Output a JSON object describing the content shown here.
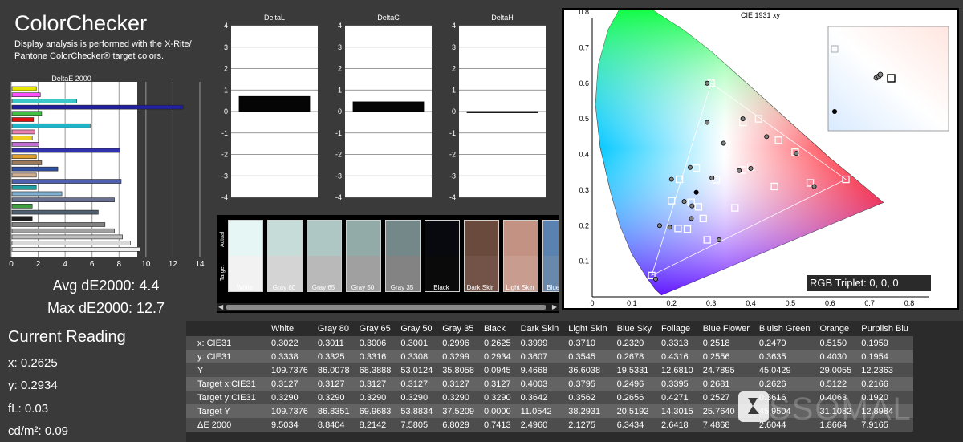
{
  "header": {
    "title": "ColorChecker",
    "subtitle": "Display analysis is performed with the X-Rite/ Pantone ColorChecker® target colors."
  },
  "deltaE_chart": {
    "title": "DeltaE 2000",
    "x_ticks": [
      "0",
      "2",
      "4",
      "6",
      "8",
      "10",
      "12",
      "14"
    ]
  },
  "summary": {
    "avg": "Avg dE2000: 4.4",
    "max": "Max dE2000: 12.7"
  },
  "current_reading": {
    "title": "Current Reading",
    "x": "x: 0.2625",
    "y": "y: 0.2934",
    "fl": "fL: 0.03",
    "cd": "cd/m²: 0.09"
  },
  "delta_charts": [
    {
      "title": "DeltaL",
      "value": 0.7
    },
    {
      "title": "DeltaC",
      "value": 0.45
    },
    {
      "title": "DeltaH",
      "value": 0.0
    }
  ],
  "delta_y_ticks": [
    "4",
    "3",
    "2",
    "1",
    "0",
    "-1",
    "-2",
    "-3",
    "-4"
  ],
  "swatches": {
    "actual_label": "Actual",
    "target_label": "Target",
    "items": [
      {
        "label": "White",
        "actual": "#e6f6f4",
        "target": "#f2f2f2"
      },
      {
        "label": "Gray 80",
        "actual": "#c6dcd8",
        "target": "#d4d4d4"
      },
      {
        "label": "Gray 65",
        "actual": "#aec6c4",
        "target": "#b9b9b9"
      },
      {
        "label": "Gray 50",
        "actual": "#92aaa8",
        "target": "#a0a0a0"
      },
      {
        "label": "Gray 35",
        "actual": "#74888a",
        "target": "#838383"
      },
      {
        "label": "Black",
        "actual": "#08090e",
        "target": "#0a0a0a"
      },
      {
        "label": "Dark Skin",
        "actual": "#6a4a3c",
        "target": "#735248"
      },
      {
        "label": "Light Skin",
        "actual": "#c49282",
        "target": "#c89c8e"
      },
      {
        "label": "Blue Sky",
        "actual": "#5a82b0",
        "target": "#6888ac"
      }
    ]
  },
  "cie": {
    "title": "CIE 1931 xy",
    "x_ticks": [
      "0",
      "0.1",
      "0.2",
      "0.3",
      "0.4",
      "0.5",
      "0.6",
      "0.7",
      "0.8"
    ],
    "y_ticks": [
      "0.8",
      "0.7",
      "0.6",
      "0.5",
      "0.4",
      "0.3",
      "0.2",
      "0.1"
    ],
    "rgb_triplet": "RGB Triplet: 0, 0, 0"
  },
  "table": {
    "columns": [
      "",
      "White",
      "Gray 80",
      "Gray 65",
      "Gray 50",
      "Gray 35",
      "Black",
      "Dark Skin",
      "Light Skin",
      "Blue Sky",
      "Foliage",
      "Blue Flower",
      "Bluish Green",
      "Orange",
      "Purplish Blu"
    ],
    "rows": [
      [
        "x: CIE31",
        "0.3022",
        "0.3011",
        "0.3006",
        "0.3001",
        "0.2996",
        "0.2625",
        "0.3999",
        "0.3710",
        "0.2320",
        "0.3313",
        "0.2518",
        "0.2470",
        "0.5150",
        "0.1959"
      ],
      [
        "y: CIE31",
        "0.3338",
        "0.3325",
        "0.3316",
        "0.3308",
        "0.3299",
        "0.2934",
        "0.3607",
        "0.3545",
        "0.2678",
        "0.4316",
        "0.2556",
        "0.3635",
        "0.4030",
        "0.1954"
      ],
      [
        "Y",
        "109.7376",
        "86.0078",
        "68.3888",
        "53.0124",
        "35.8058",
        "0.0945",
        "9.4668",
        "36.6038",
        "19.5331",
        "12.6810",
        "24.7895",
        "45.0429",
        "29.0055",
        "12.2363"
      ],
      [
        "Target x:CIE31",
        "0.3127",
        "0.3127",
        "0.3127",
        "0.3127",
        "0.3127",
        "0.3127",
        "0.4003",
        "0.3795",
        "0.2496",
        "0.3395",
        "0.2681",
        "0.2626",
        "0.5122",
        "0.2166"
      ],
      [
        "Target y:CIE31",
        "0.3290",
        "0.3290",
        "0.3290",
        "0.3290",
        "0.3290",
        "0.3290",
        "0.3642",
        "0.3562",
        "0.2656",
        "0.4271",
        "0.2527",
        "0.3616",
        "0.4063",
        "0.1920"
      ],
      [
        "Target Y",
        "109.7376",
        "86.8351",
        "69.9683",
        "53.8834",
        "37.5209",
        "0.0000",
        "11.0542",
        "38.2931",
        "20.5192",
        "14.3015",
        "25.7640",
        "45.9504",
        "31.1082",
        "12.8984"
      ],
      [
        "ΔE 2000",
        "9.5034",
        "8.8404",
        "8.2142",
        "7.5805",
        "6.8029",
        "0.7413",
        "2.4960",
        "2.1275",
        "6.3434",
        "2.6418",
        "7.4868",
        "2.6044",
        "1.8664",
        "7.9165"
      ]
    ]
  },
  "watermark": "SSOMAL"
}
